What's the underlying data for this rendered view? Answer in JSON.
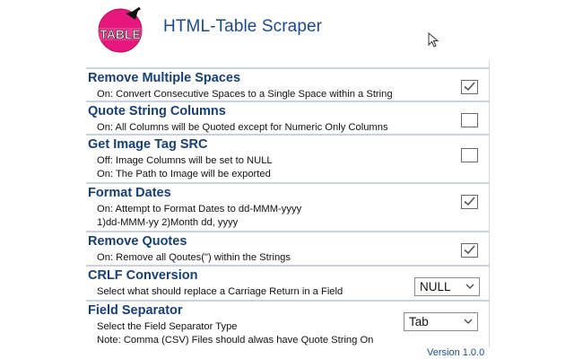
{
  "header": {
    "logo_text": "TABLE",
    "title": "HTML-Table Scraper"
  },
  "options": [
    {
      "title": "Remove Multiple Spaces",
      "descriptions": [
        "On: Convert Consecutive Spaces to a Single Space within a String"
      ],
      "checked": true
    },
    {
      "title": "Quote String Columns",
      "descriptions": [
        "On: All Columns will be Quoted except for Numeric Only Columns"
      ],
      "checked": false
    },
    {
      "title": "Get Image Tag SRC",
      "descriptions": [
        "Off: Image Columns will be set to NULL",
        "On: The Path to Image will be exported"
      ],
      "checked": false
    },
    {
      "title": "Format Dates",
      "descriptions": [
        "On: Attempt to Format Dates to dd-MMM-yyyy",
        "1)dd-MMM-yy 2)Month dd, yyyy"
      ],
      "checked": true
    },
    {
      "title": "Remove Quotes",
      "descriptions": [
        "On: Remove all Qoutes(\") within the Strings"
      ],
      "checked": true
    },
    {
      "title": "CRLF Conversion",
      "descriptions": [
        "Select what should replace a Carriage Return in a Field"
      ],
      "selected": "NULL"
    },
    {
      "title": "Field Separator",
      "descriptions": [
        "Select the Field Separator Type",
        "Note: Comma (CSV) Files should alwas have Quote String On"
      ],
      "selected": "Tab"
    }
  ],
  "footer": {
    "version": "Version 1.0.0"
  },
  "colors": {
    "title": "#1a4b8c",
    "option_title": "#173f78",
    "logo_pink": "#e8177d",
    "divider": "#c9d2de"
  },
  "icons": {
    "logo": "table-logo-icon",
    "cursor": "mouse-pointer-icon",
    "check": "checkmark-icon",
    "dropdown": "chevron-down-icon"
  }
}
